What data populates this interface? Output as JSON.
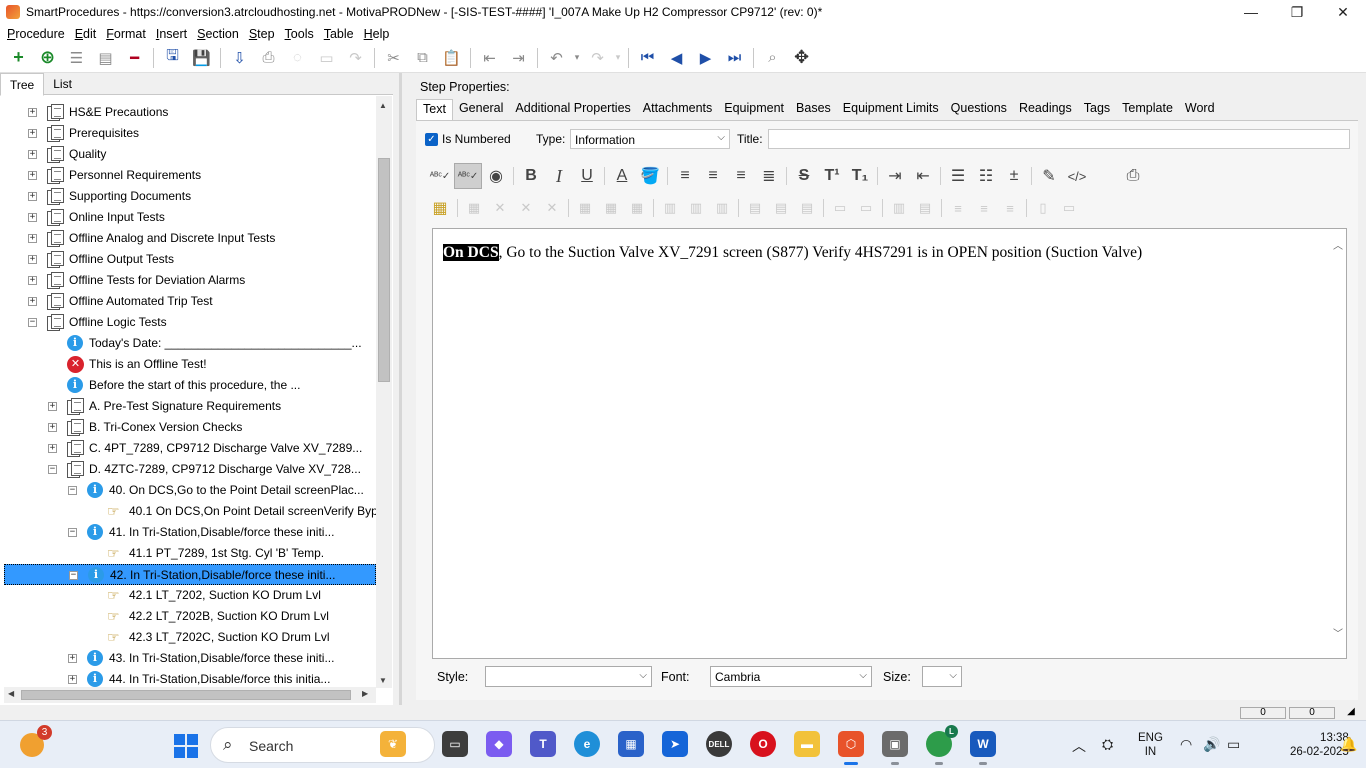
{
  "window": {
    "title": "SmartProcedures - https://conversion3.atrcloudhosting.net - MotivaPRODNew - [-SIS-TEST-####] 'I_007A Make Up H2 Compressor CP9712' (rev: 0)*",
    "minimize_glyph": "—",
    "maximize_glyph": "❐",
    "close_glyph": "✕"
  },
  "menu": [
    "Procedure",
    "Edit",
    "Format",
    "Insert",
    "Section",
    "Step",
    "Tools",
    "Table",
    "Help"
  ],
  "left_panel": {
    "tabs": [
      "Tree",
      "List"
    ],
    "active_tab": "Tree",
    "tree": [
      {
        "label": "HS&E Precautions",
        "icon": "document-stack-icon",
        "expander": "+"
      },
      {
        "label": "Prerequisites",
        "icon": "document-stack-icon",
        "expander": "+"
      },
      {
        "label": "Quality",
        "icon": "document-stack-icon",
        "expander": "+"
      },
      {
        "label": "Personnel Requirements",
        "icon": "document-stack-icon",
        "expander": "+"
      },
      {
        "label": "Supporting Documents",
        "icon": "document-stack-icon",
        "expander": "+"
      },
      {
        "label": "Online Input Tests",
        "icon": "document-stack-icon",
        "expander": "+"
      },
      {
        "label": "Offline Analog and Discrete Input Tests",
        "icon": "document-stack-icon",
        "expander": "+"
      },
      {
        "label": "Offline Output Tests",
        "icon": "document-stack-icon",
        "expander": "+"
      },
      {
        "label": "Offline Tests for Deviation Alarms",
        "icon": "document-stack-icon",
        "expander": "+"
      },
      {
        "label": "Offline Automated Trip Test",
        "icon": "document-stack-icon",
        "expander": "+"
      },
      {
        "label": "Offline Logic Tests",
        "icon": "document-stack-icon",
        "expander": "−"
      },
      {
        "label": "Today's Date: ____________________________...",
        "icon": "info-icon",
        "expander": ""
      },
      {
        "label": "This is an Offline Test!",
        "icon": "error-icon",
        "expander": ""
      },
      {
        "label": "Before the start of this procedure, the ...",
        "icon": "info-icon",
        "expander": ""
      },
      {
        "label": "A. Pre-Test Signature Requirements",
        "icon": "document-stack-icon",
        "expander": "+"
      },
      {
        "label": "B. Tri-Conex Version Checks",
        "icon": "document-stack-icon",
        "expander": "+"
      },
      {
        "label": "C. 4PT_7289, CP9712 Discharge Valve XV_7289...",
        "icon": "document-stack-icon",
        "expander": "+"
      },
      {
        "label": "D. 4ZTC-7289, CP9712 Discharge Valve XV_728...",
        "icon": "document-stack-icon",
        "expander": "−"
      },
      {
        "label": "40. On DCS,Go to the Point Detail screenPlac...",
        "icon": "info-icon",
        "expander": "−"
      },
      {
        "label": "40.1 On DCS,On Point Detail screenVerify Byp...",
        "icon": "pointing-hand-icon",
        "expander": ""
      },
      {
        "label": "41. In Tri-Station,Disable/force these initi...",
        "icon": "info-icon",
        "expander": "−"
      },
      {
        "label": "41.1 PT_7289, 1st Stg. Cyl 'B' Temp.",
        "icon": "pointing-hand-icon",
        "expander": ""
      },
      {
        "label": "42. In Tri-Station,Disable/force these initi...",
        "icon": "info-icon",
        "expander": "−"
      },
      {
        "label": "42.1 LT_7202, Suction KO Drum Lvl",
        "icon": "pointing-hand-icon",
        "expander": ""
      },
      {
        "label": "42.2 LT_7202B, Suction KO Drum Lvl",
        "icon": "pointing-hand-icon",
        "expander": ""
      },
      {
        "label": "42.3 LT_7202C, Suction KO Drum Lvl",
        "icon": "pointing-hand-icon",
        "expander": ""
      },
      {
        "label": "43. In Tri-Station,Disable/force these initi...",
        "icon": "info-icon",
        "expander": "+"
      },
      {
        "label": "44. In Tri-Station,Disable/force this initia...",
        "icon": "info-icon",
        "expander": "+"
      }
    ]
  },
  "step_properties": {
    "heading": "Step Properties:",
    "tabs": [
      "Text",
      "General",
      "Additional Properties",
      "Attachments",
      "Equipment",
      "Bases",
      "Equipment Limits",
      "Questions",
      "Readings",
      "Tags",
      "Template",
      "Word"
    ],
    "active_tab": "Text",
    "is_numbered_label": "Is Numbered",
    "is_numbered_checked": true,
    "type_label": "Type:",
    "type_value": "Information",
    "title_label": "Title:",
    "title_value": "",
    "editor_highlight": "On DCS",
    "editor_rest": ", Go to the Suction Valve XV_7291 screen (S877) Verify 4HS7291 is in OPEN position (Suction Valve)",
    "style_label": "Style:",
    "style_value": "",
    "font_label": "Font:",
    "font_value": "Cambria",
    "size_label": "Size:",
    "size_value": ""
  },
  "status": {
    "field1": "0",
    "field2": "0"
  },
  "taskbar": {
    "weather_badge": "3",
    "search_placeholder": "Search",
    "lang_line1": "ENG",
    "lang_line2": "IN",
    "time": "13:38",
    "date": "26-02-2025",
    "chrome_badge": "L"
  }
}
